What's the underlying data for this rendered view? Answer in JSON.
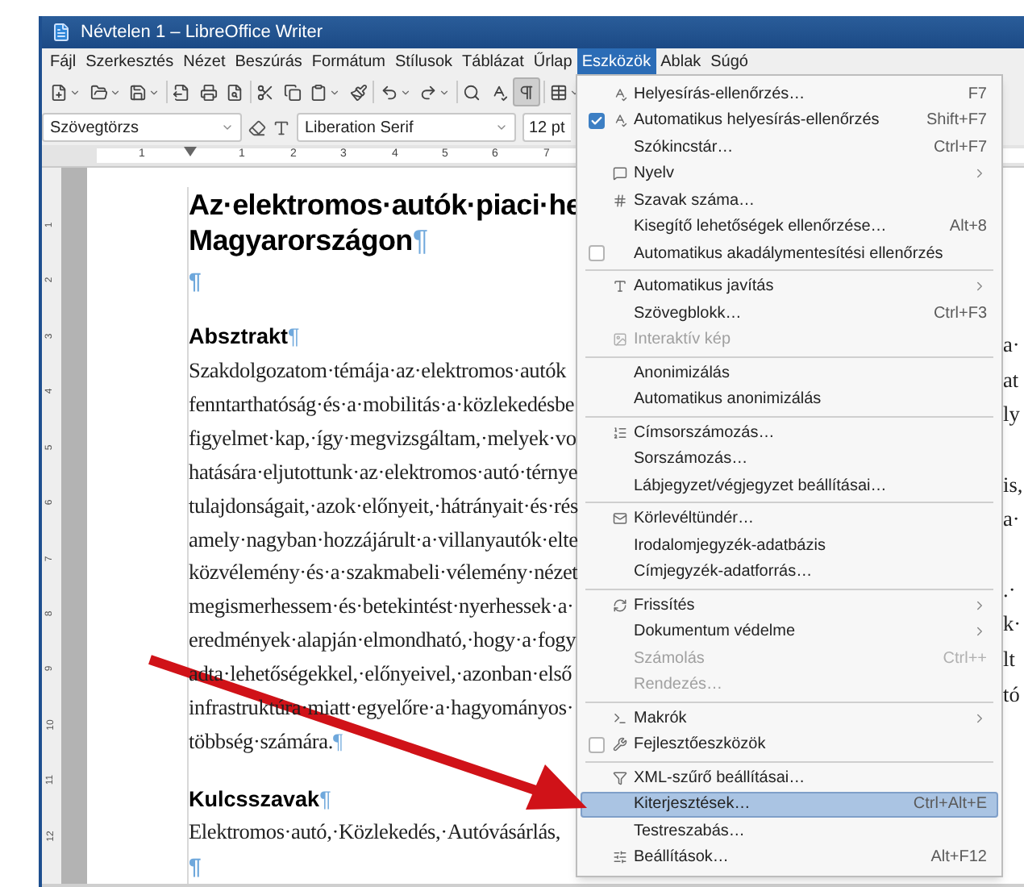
{
  "window": {
    "title": "Névtelen 1 – LibreOffice Writer"
  },
  "menubar": [
    {
      "label": "Fájl",
      "selected": false
    },
    {
      "label": "Szerkesztés",
      "selected": false
    },
    {
      "label": "Nézet",
      "selected": false
    },
    {
      "label": "Beszúrás",
      "selected": false
    },
    {
      "label": "Formátum",
      "selected": false
    },
    {
      "label": "Stílusok",
      "selected": false
    },
    {
      "label": "Táblázat",
      "selected": false
    },
    {
      "label": "Űrlap",
      "selected": false
    },
    {
      "label": "Eszközök",
      "selected": true
    },
    {
      "label": "Ablak",
      "selected": false
    },
    {
      "label": "Súgó",
      "selected": false
    }
  ],
  "toolbar": [
    {
      "kind": "button",
      "dropdown": true,
      "pressed": false
    },
    {
      "kind": "button",
      "dropdown": true,
      "pressed": false
    },
    {
      "kind": "button",
      "dropdown": true,
      "pressed": false
    },
    {
      "kind": "separator"
    },
    {
      "kind": "button",
      "dropdown": false,
      "pressed": false
    },
    {
      "kind": "button",
      "dropdown": false,
      "pressed": false
    },
    {
      "kind": "button",
      "dropdown": false,
      "pressed": false
    },
    {
      "kind": "separator"
    },
    {
      "kind": "button",
      "dropdown": false,
      "pressed": false
    },
    {
      "kind": "button",
      "dropdown": false,
      "pressed": false
    },
    {
      "kind": "button",
      "dropdown": true,
      "pressed": false
    },
    {
      "kind": "button",
      "dropdown": false,
      "pressed": false
    },
    {
      "kind": "separator"
    },
    {
      "kind": "button",
      "dropdown": true,
      "pressed": false
    },
    {
      "kind": "button",
      "dropdown": true,
      "pressed": false
    },
    {
      "kind": "separator"
    },
    {
      "kind": "button",
      "dropdown": false,
      "pressed": false
    },
    {
      "kind": "button",
      "dropdown": false,
      "pressed": false
    },
    {
      "kind": "button",
      "dropdown": false,
      "pressed": true
    },
    {
      "kind": "separator"
    },
    {
      "kind": "button",
      "dropdown": true,
      "pressed": false
    }
  ],
  "format_bar": {
    "paragraph_style": "Szövegtörzs",
    "font_name": "Liberation Serif",
    "font_size": "12 pt"
  },
  "ruler": {
    "left_number": "1",
    "numbers": [
      "1",
      "2",
      "3",
      "4",
      "5",
      "6",
      "7"
    ],
    "vertical_numbers": [
      "1",
      "2",
      "3",
      "4",
      "5",
      "6",
      "7",
      "8",
      "9",
      "10",
      "11",
      "12"
    ]
  },
  "document": {
    "mark": "¶",
    "title_lines": [
      {
        "text": "Az·elektromos·autók·piaci·he",
        "mark": false
      },
      {
        "text": "Magyarországon",
        "mark": true
      }
    ],
    "blocks": [
      {
        "kind": "empty"
      },
      {
        "kind": "heading",
        "text": "Absztrakt",
        "mark": true
      },
      {
        "kind": "body",
        "text": "Szakdolgozatom·témája·az·elektromos·autók",
        "tail": "a·",
        "mark": false
      },
      {
        "kind": "body",
        "text": "fenntarthatóság·és·a·mobilitás·a·közlekedésbe",
        "tail": "at",
        "mark": false
      },
      {
        "kind": "body",
        "text": "figyelmet·kap,·így·megvizsgáltam,·melyek·vo",
        "tail": "ly",
        "mark": false
      },
      {
        "kind": "body",
        "text": "hatására·eljutottunk·az·elektromos·autó·térnye",
        "mark": false
      },
      {
        "kind": "body",
        "text": "tulajdonságait,·azok·előnyeit,·hátrányait·és·rés",
        "tail": "is,",
        "mark": false
      },
      {
        "kind": "body",
        "text": "amely·nagyban·hozzájárult·a·villanyautók·elte",
        "tail": "a·",
        "mark": false
      },
      {
        "kind": "body",
        "text": "közvélemény·és·a·szakmabeli·vélemény·nézet",
        "mark": false
      },
      {
        "kind": "body",
        "text": "megismerhessem·és·betekintést·nyerhessek·a·",
        "tail": ".·",
        "mark": false
      },
      {
        "kind": "body",
        "text": "eredmények·alapján·elmondható,·hogy·a·fogy",
        "tail": "k·",
        "mark": false
      },
      {
        "kind": "body",
        "text": "adta·lehetőségekkel,·előnyeivel,·azonban·első",
        "tail": "lt",
        "mark": false
      },
      {
        "kind": "body",
        "text": "infrastruktúra·miatt·egyelőre·a·hagyományos·",
        "tail": "tó",
        "mark": false
      },
      {
        "kind": "body",
        "text": "többség·számára.",
        "mark": true
      },
      {
        "kind": "heading",
        "text": "Kulcsszavak",
        "mark": true
      },
      {
        "kind": "body",
        "text": "Elektromos·autó,·Közlekedés,·Autóvásárlás,",
        "mark": false
      },
      {
        "kind": "empty"
      }
    ]
  },
  "menu": [
    {
      "kind": "item",
      "label": "Helyesírás-ellenőrzés…",
      "shortcut": "F7",
      "disabled": false,
      "selected": false
    },
    {
      "kind": "check",
      "label": "Automatikus helyesírás-ellenőrzés",
      "shortcut": "Shift+F7",
      "checked": true,
      "disabled": false,
      "selected": false
    },
    {
      "kind": "item",
      "label": "Szókincstár…",
      "shortcut": "Ctrl+F7",
      "disabled": false,
      "selected": false
    },
    {
      "kind": "item",
      "label": "Nyelv",
      "submenu": true,
      "disabled": false,
      "selected": false
    },
    {
      "kind": "item",
      "label": "Szavak száma…",
      "disabled": false,
      "selected": false
    },
    {
      "kind": "item",
      "label": "Kisegítő lehetőségek ellenőrzése…",
      "shortcut": "Alt+8",
      "disabled": false,
      "selected": false
    },
    {
      "kind": "check",
      "label": "Automatikus akadálymentesítési ellenőrzés",
      "checked": false,
      "disabled": false,
      "selected": false
    },
    {
      "kind": "separator"
    },
    {
      "kind": "item",
      "label": "Automatikus javítás",
      "submenu": true,
      "disabled": false,
      "selected": false
    },
    {
      "kind": "item",
      "label": "Szövegblokk…",
      "shortcut": "Ctrl+F3",
      "disabled": false,
      "selected": false
    },
    {
      "kind": "item",
      "label": "Interaktív kép",
      "disabled": true,
      "selected": false
    },
    {
      "kind": "separator"
    },
    {
      "kind": "item",
      "label": "Anonimizálás",
      "disabled": false,
      "selected": false
    },
    {
      "kind": "item",
      "label": "Automatikus anonimizálás",
      "disabled": false,
      "selected": false
    },
    {
      "kind": "separator"
    },
    {
      "kind": "item",
      "label": "Címsorszámozás…",
      "disabled": false,
      "selected": false
    },
    {
      "kind": "item",
      "label": "Sorszámozás…",
      "disabled": false,
      "selected": false
    },
    {
      "kind": "item",
      "label": "Lábjegyzet/végjegyzet beállításai…",
      "disabled": false,
      "selected": false
    },
    {
      "kind": "separator"
    },
    {
      "kind": "item",
      "label": "Körlevéltündér…",
      "disabled": false,
      "selected": false
    },
    {
      "kind": "item",
      "label": "Irodalomjegyzék-adatbázis",
      "disabled": false,
      "selected": false
    },
    {
      "kind": "item",
      "label": "Címjegyzék-adatforrás…",
      "disabled": false,
      "selected": false
    },
    {
      "kind": "separator"
    },
    {
      "kind": "item",
      "label": "Frissítés",
      "submenu": true,
      "disabled": false,
      "selected": false
    },
    {
      "kind": "item",
      "label": "Dokumentum védelme",
      "submenu": true,
      "disabled": false,
      "selected": false
    },
    {
      "kind": "item",
      "label": "Számolás",
      "shortcut": "Ctrl++",
      "disabled": true,
      "selected": false
    },
    {
      "kind": "item",
      "label": "Rendezés…",
      "disabled": true,
      "selected": false
    },
    {
      "kind": "separator"
    },
    {
      "kind": "item",
      "label": "Makrók",
      "submenu": true,
      "disabled": false,
      "selected": false
    },
    {
      "kind": "check",
      "label": "Fejlesztőeszközök",
      "checked": false,
      "disabled": false,
      "selected": false
    },
    {
      "kind": "separator"
    },
    {
      "kind": "item",
      "label": "XML-szűrő beállításai…",
      "disabled": false,
      "selected": false
    },
    {
      "kind": "item",
      "label": "Kiterjesztések…",
      "shortcut": "Ctrl+Alt+E",
      "disabled": false,
      "selected": true
    },
    {
      "kind": "item",
      "label": "Testreszabás…",
      "disabled": false,
      "selected": false
    },
    {
      "kind": "item",
      "label": "Beállítások…",
      "shortcut": "Alt+F12",
      "disabled": false,
      "selected": false
    }
  ]
}
